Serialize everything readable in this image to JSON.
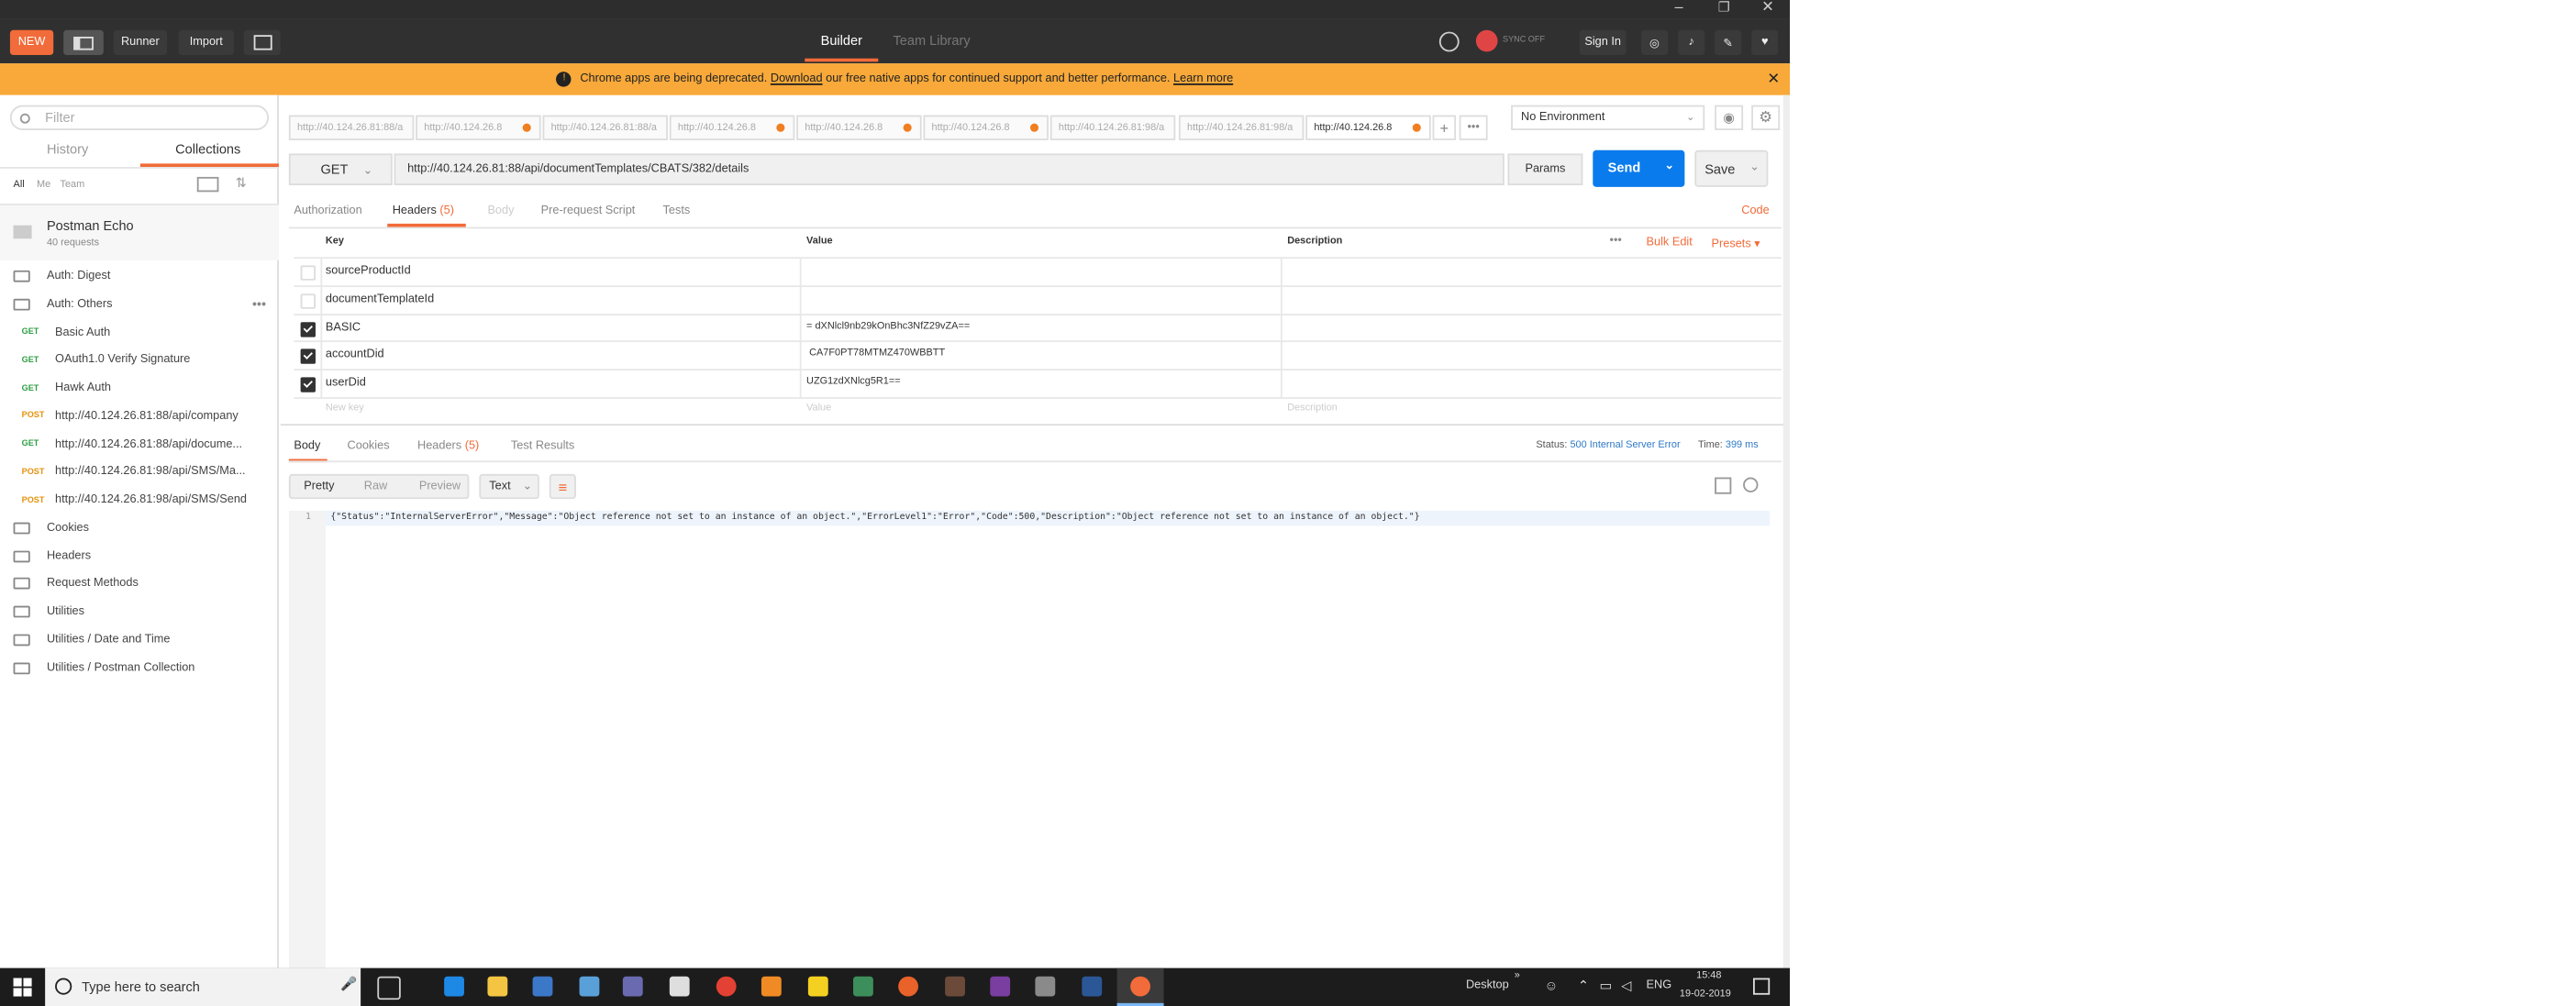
{
  "header": {
    "new_label": "NEW",
    "runner_label": "Runner",
    "import_label": "Import",
    "tab_builder": "Builder",
    "tab_team_library": "Team Library",
    "sync_label": "SYNC OFF",
    "signin_label": "Sign In"
  },
  "banner": {
    "text_before": "Chrome apps are being deprecated.",
    "download_link": "Download",
    "text_after": "our free native apps for continued support and better performance.",
    "learn_more_link": "Learn more"
  },
  "sidebar": {
    "filter_placeholder": "Filter",
    "tab_history": "History",
    "tab_collections": "Collections",
    "filter_all": "All",
    "filter_me": "Me",
    "filter_team": "Team",
    "collection_name": "Postman Echo",
    "collection_count": "40 requests",
    "items": [
      {
        "type": "folder",
        "label": "Auth: Digest"
      },
      {
        "type": "folder-open",
        "label": "Auth: Others"
      },
      {
        "type": "request",
        "method": "GET",
        "label": "Basic Auth"
      },
      {
        "type": "request",
        "method": "GET",
        "label": "OAuth1.0 Verify Signature"
      },
      {
        "type": "request",
        "method": "GET",
        "label": "Hawk Auth"
      },
      {
        "type": "request",
        "method": "POST",
        "label": "http://40.124.26.81:88/api/company"
      },
      {
        "type": "request",
        "method": "GET",
        "label": "http://40.124.26.81:88/api/docume..."
      },
      {
        "type": "request",
        "method": "POST",
        "label": "http://40.124.26.81:98/api/SMS/Ma..."
      },
      {
        "type": "request",
        "method": "POST",
        "label": "http://40.124.26.81:98/api/SMS/Send"
      },
      {
        "type": "folder",
        "label": "Cookies"
      },
      {
        "type": "folder",
        "label": "Headers"
      },
      {
        "type": "folder",
        "label": "Request Methods"
      },
      {
        "type": "folder",
        "label": "Utilities"
      },
      {
        "type": "folder",
        "label": "Utilities / Date and Time"
      },
      {
        "type": "folder",
        "label": "Utilities / Postman Collection"
      }
    ]
  },
  "request_tabs": [
    {
      "label": "http://40.124.26.81:88/a",
      "dirty": false
    },
    {
      "label": "http://40.124.26.8",
      "dirty": true
    },
    {
      "label": "http://40.124.26.81:88/a",
      "dirty": false
    },
    {
      "label": "http://40.124.26.8",
      "dirty": true
    },
    {
      "label": "http://40.124.26.8",
      "dirty": true
    },
    {
      "label": "http://40.124.26.8",
      "dirty": true
    },
    {
      "label": "http://40.124.26.81:98/a",
      "dirty": false
    },
    {
      "label": "http://40.124.26.81:98/a",
      "dirty": false
    },
    {
      "label": "http://40.124.26.8",
      "dirty": true
    }
  ],
  "environment": {
    "selected": "No Environment"
  },
  "request": {
    "method": "GET",
    "url": "http://40.124.26.81:88/api/documentTemplates/CBATS/382/details",
    "params_label": "Params",
    "send_label": "Send",
    "save_label": "Save"
  },
  "request_subtabs": {
    "authorization": "Authorization",
    "headers": "Headers",
    "headers_count": "(5)",
    "body": "Body",
    "prerequest": "Pre-request Script",
    "tests": "Tests",
    "code_link": "Code"
  },
  "headers_table": {
    "col_key": "Key",
    "col_value": "Value",
    "col_description": "Description",
    "bulk_edit": "Bulk Edit",
    "presets": "Presets",
    "rows": [
      {
        "checked": false,
        "key": "sourceProductId",
        "value": ""
      },
      {
        "checked": false,
        "key": "documentTemplateId",
        "value": ""
      },
      {
        "checked": true,
        "key": "BASIC",
        "value": "= dXNlcl9nb29kOnBhc3NfZ29vZA=="
      },
      {
        "checked": true,
        "key": "accountDid",
        "value": " CA7F0PT78MTMZ470WBBTT"
      },
      {
        "checked": true,
        "key": "userDid",
        "value": "UZG1zdXNlcg5R1=="
      }
    ],
    "new_key_placeholder": "New key",
    "new_value_placeholder": "Value",
    "new_desc_placeholder": "Description"
  },
  "response": {
    "tab_body": "Body",
    "tab_cookies": "Cookies",
    "tab_headers": "Headers",
    "tab_headers_count": "(5)",
    "tab_test_results": "Test Results",
    "status_label": "Status:",
    "status_value": "500 Internal Server Error",
    "time_label": "Time:",
    "time_value": "399 ms",
    "view_pretty": "Pretty",
    "view_raw": "Raw",
    "view_preview": "Preview",
    "format": "Text",
    "line_number": "1",
    "body_text": "{\"Status\":\"InternalServerError\",\"Message\":\"Object reference not set to an instance of an object.\",\"ErrorLevel1\":\"Error\",\"Code\":500,\"Description\":\"Object reference not set to an instance of an object.\"}"
  },
  "taskbar": {
    "search_placeholder": "Type here to search",
    "desktop_label": "Desktop",
    "language": "ENG",
    "time": "15:48",
    "date": "19-02-2019"
  },
  "colors": {
    "accent_orange": "#f26b3a",
    "send_blue": "#097bed",
    "banner_yellow": "#f8a93a",
    "header_dark": "#303030"
  }
}
